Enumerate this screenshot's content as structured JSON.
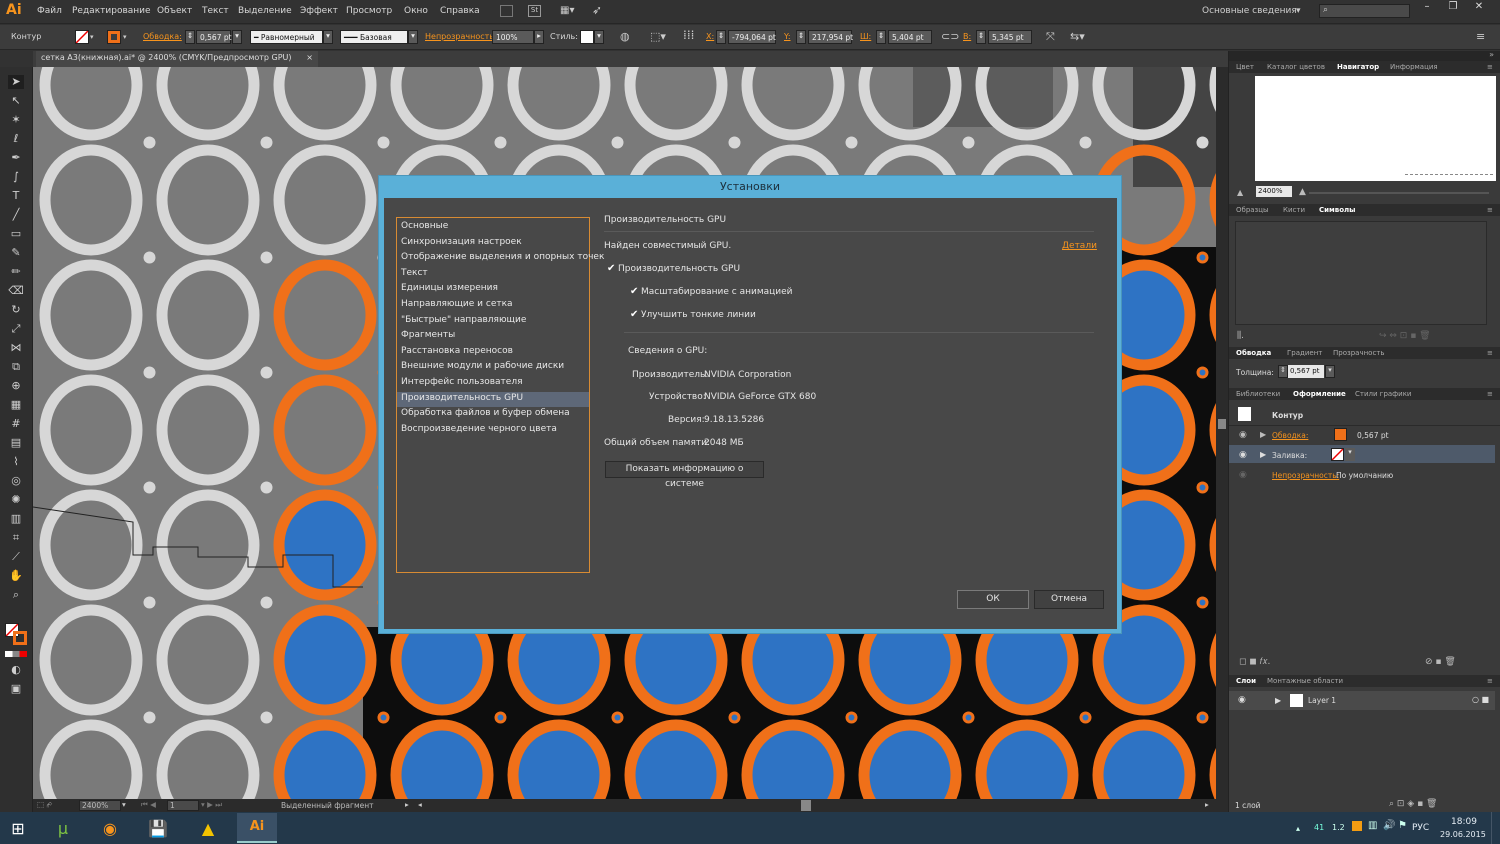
{
  "app": {
    "logo": "Ai",
    "workspace": "Основные сведения"
  },
  "menu": [
    "Файл",
    "Редактирование",
    "Объект",
    "Текст",
    "Выделение",
    "Эффект",
    "Просмотр",
    "Окно",
    "Справка"
  ],
  "control": {
    "object_type": "Контур",
    "stroke_label": "Обводка:",
    "stroke_value": "0,567 pt",
    "profile": "Равномерный",
    "brush": "Базовая",
    "opacity_label": "Непрозрачность:",
    "opacity_value": "100%",
    "style_label": "Стиль:",
    "x_label": "X:",
    "x_value": "-794,064 pt",
    "y_label": "Y:",
    "y_value": "217,954 pt",
    "w_label": "Ш:",
    "w_value": "5,404 pt",
    "h_label": "В:",
    "h_value": "5,345 pt"
  },
  "document_tab": {
    "title": "сетка А3(книжная).ai* @ 2400% (CMYK/Предпросмотр GPU)",
    "close": "×"
  },
  "dialog": {
    "title": "Установки",
    "categories": [
      "Основные",
      "Синхронизация настроек",
      "Отображение выделения и опорных точек",
      "Текст",
      "Единицы измерения",
      "Направляющие и сетка",
      "\"Быстрые\" направляющие",
      "Фрагменты",
      "Расстановка переносов",
      "Внешние модули и рабочие диски",
      "Интерфейс пользователя",
      "Производительность GPU",
      "Обработка файлов и буфер обмена",
      "Воспроизведение черного цвета"
    ],
    "selected_index": 11,
    "section_title": "Производительность GPU",
    "found": "Найден совместимый GPU.",
    "details_link": "Детали",
    "cb_gpu": "Производительность GPU",
    "cb_anim": "Масштабирование с анимацией",
    "cb_lines": "Улучшить тонкие линии",
    "info_header": "Сведения о GPU:",
    "vendor_label": "Производитель:",
    "vendor_value": "NVIDIA Corporation",
    "device_label": "Устройство:",
    "device_value": "NVIDIA GeForce GTX 680",
    "version_label": "Версия:",
    "version_value": "9.18.13.5286",
    "memory_label": "Общий объем памяти:",
    "memory_value": "2048 МБ",
    "sysinfo_button": "Показать информацию о системе",
    "ok": "ОК",
    "cancel": "Отмена"
  },
  "panels": {
    "nav_tabs": [
      "Цвет",
      "Каталог цветов",
      "Навигатор",
      "Информация"
    ],
    "nav_zoom": "2400%",
    "sym_tabs": [
      "Образцы",
      "Кисти",
      "Символы"
    ],
    "stroke_tabs": [
      "Обводка",
      "Градиент",
      "Прозрачность"
    ],
    "weight_label": "Толщина:",
    "weight_value": "0,567 pt",
    "app_tabs": [
      "Библиотеки",
      "Оформление",
      "Стили графики"
    ],
    "app_header": "Контур",
    "app_stroke": "Обводка:",
    "app_stroke_val": "0,567 pt",
    "app_fill": "Заливка:",
    "app_opacity": "Непрозрачность:",
    "app_opacity_val": "По умолчанию",
    "layer_tabs": [
      "Слои",
      "Монтажные области"
    ],
    "layer_name": "Layer 1",
    "layer_count": "1 слой"
  },
  "status": {
    "zoom": "2400%",
    "page": "1",
    "tool": "Выделенный фрагмент"
  },
  "taskbar": {
    "lang": "РУС",
    "time": "18:09",
    "date": "29.06.2015",
    "tray1": "41",
    "tray2": "1.2"
  },
  "colors": {
    "orange": "#f07019",
    "blue": "#2e73c4",
    "ring_gray": "#d7d7d7",
    "dialog_frame": "#5ab0d8"
  }
}
